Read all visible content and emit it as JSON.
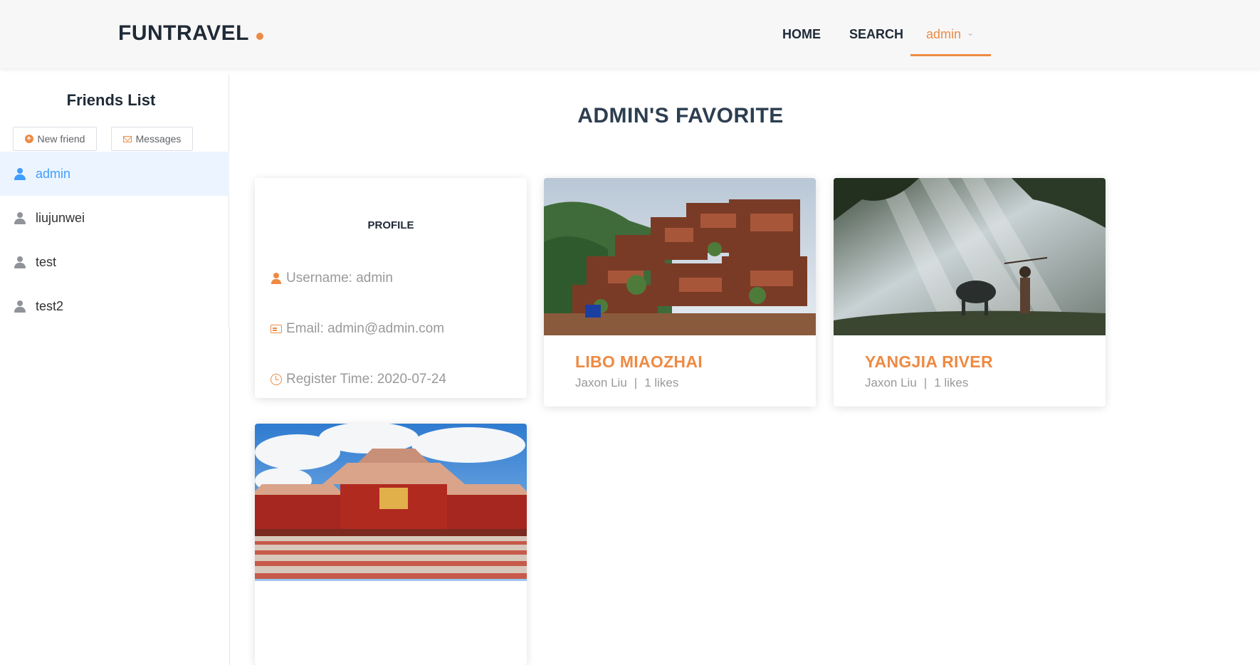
{
  "header": {
    "logo": "FUNTRAVEL",
    "nav": {
      "home": "HOME",
      "search": "SEARCH",
      "user": "admin"
    },
    "accent_color": "#ee8a43"
  },
  "sidebar": {
    "title": "Friends List",
    "new_friend_label": "New friend",
    "messages_label": "Messages",
    "friends": [
      {
        "name": "admin",
        "active": true
      },
      {
        "name": "liujunwei",
        "active": false
      },
      {
        "name": "test",
        "active": false
      },
      {
        "name": "test2",
        "active": false
      }
    ]
  },
  "main": {
    "title": "ADMIN'S FAVORITE",
    "profile": {
      "title": "PROFILE",
      "username": "Username: admin",
      "email": "Email: admin@admin.com",
      "register_time": "Register Time: 2020-07-24"
    },
    "places": [
      {
        "name": "LIBO MIAOZHAI",
        "author": "Jaxon Liu",
        "separator": "|",
        "likes": "1 likes"
      },
      {
        "name": "YANGJIA RIVER",
        "author": "Jaxon Liu",
        "separator": "|",
        "likes": "1 likes"
      },
      {
        "name": "",
        "author": "",
        "separator": "",
        "likes": ""
      }
    ]
  }
}
